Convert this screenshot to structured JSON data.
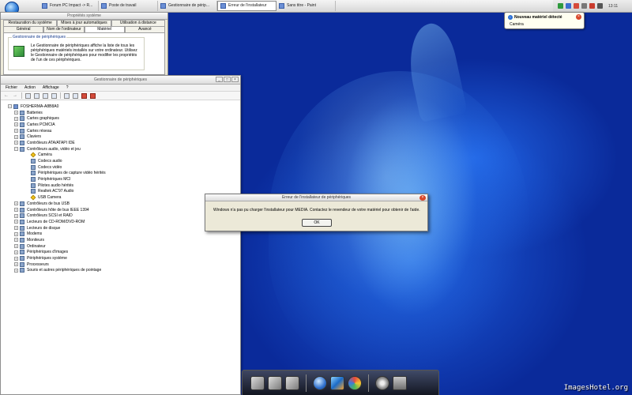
{
  "taskbar": {
    "items": [
      {
        "label": "Forum PC Impact -> R...",
        "active": false
      },
      {
        "label": "Poste de travail",
        "active": false
      },
      {
        "label": "Gestionnaire de périp...",
        "active": false
      },
      {
        "label": "Erreur de l'installateur",
        "active": true
      },
      {
        "label": "Sans titre - Paint",
        "active": false
      }
    ],
    "clock": "13:11"
  },
  "balloon": {
    "title": "Nouveau matériel détecté",
    "body": "Caméra"
  },
  "system_properties": {
    "title": "Propriétés système",
    "tabs_row1": [
      "Restauration du système",
      "Mises à jour automatiques",
      "Utilisation à distance"
    ],
    "tabs_row2": [
      "Général",
      "Nom de l'ordinateur",
      "Matériel",
      "Avancé"
    ],
    "selected_tab": "Matériel",
    "group_label": "Gestionnaire de périphériques",
    "group_text": "Le Gestionnaire de périphériques affiche la liste de tous les périphériques matériels installés sur votre ordinateur. Utilisez le Gestionnaire de périphériques pour modifier les propriétés de l'un de ces périphériques."
  },
  "device_manager": {
    "title": "Gestionnaire de périphériques",
    "menu": [
      "Fichier",
      "Action",
      "Affichage",
      "?"
    ],
    "tree": [
      {
        "label": "FOSHERMA-A8B8A0",
        "level": 0,
        "expander": "-",
        "icon": "computer"
      },
      {
        "label": "Batteries",
        "level": 1,
        "expander": "+",
        "icon": "battery"
      },
      {
        "label": "Cartes graphiques",
        "level": 1,
        "expander": "+",
        "icon": "display"
      },
      {
        "label": "Cartes PCMCIA",
        "level": 1,
        "expander": "+",
        "icon": "pcmcia"
      },
      {
        "label": "Cartes réseau",
        "level": 1,
        "expander": "+",
        "icon": "network"
      },
      {
        "label": "Claviers",
        "level": 1,
        "expander": "+",
        "icon": "keyboard"
      },
      {
        "label": "Contrôleurs ATA/ATAPI IDE",
        "level": 1,
        "expander": "+",
        "icon": "ide"
      },
      {
        "label": "Contrôleurs audio, vidéo et jeu",
        "level": 1,
        "expander": "-",
        "icon": "audio"
      },
      {
        "label": "Caméra",
        "level": 2,
        "expander": "",
        "icon": "warning"
      },
      {
        "label": "Codecs audio",
        "level": 2,
        "expander": "",
        "icon": "codec"
      },
      {
        "label": "Codecs vidéo",
        "level": 2,
        "expander": "",
        "icon": "codec"
      },
      {
        "label": "Périphériques de capture vidéo hérités",
        "level": 2,
        "expander": "",
        "icon": "codec"
      },
      {
        "label": "Périphériques MCI",
        "level": 2,
        "expander": "",
        "icon": "codec"
      },
      {
        "label": "Pilotes audio hérités",
        "level": 2,
        "expander": "",
        "icon": "codec"
      },
      {
        "label": "Realtek AC'97 Audio",
        "level": 2,
        "expander": "",
        "icon": "codec"
      },
      {
        "label": "USB Camera",
        "level": 2,
        "expander": "",
        "icon": "warning"
      },
      {
        "label": "Contrôleurs de bus USB",
        "level": 1,
        "expander": "+",
        "icon": "usb"
      },
      {
        "label": "Contrôleurs hôte de bus IEEE 1394",
        "level": 1,
        "expander": "+",
        "icon": "ieee"
      },
      {
        "label": "Contrôleurs SCSI et RAID",
        "level": 1,
        "expander": "+",
        "icon": "scsi"
      },
      {
        "label": "Lecteurs de CD-ROM/DVD-ROM",
        "level": 1,
        "expander": "+",
        "icon": "cdrom"
      },
      {
        "label": "Lecteurs de disque",
        "level": 1,
        "expander": "+",
        "icon": "disk"
      },
      {
        "label": "Modems",
        "level": 1,
        "expander": "+",
        "icon": "modem"
      },
      {
        "label": "Moniteurs",
        "level": 1,
        "expander": "+",
        "icon": "monitor"
      },
      {
        "label": "Ordinateur",
        "level": 1,
        "expander": "+",
        "icon": "computer"
      },
      {
        "label": "Périphériques d'images",
        "level": 1,
        "expander": "+",
        "icon": "imaging"
      },
      {
        "label": "Périphériques système",
        "level": 1,
        "expander": "+",
        "icon": "system"
      },
      {
        "label": "Processeurs",
        "level": 1,
        "expander": "+",
        "icon": "cpu"
      },
      {
        "label": "Souris et autres périphériques de pointage",
        "level": 1,
        "expander": "+",
        "icon": "mouse"
      }
    ]
  },
  "error_dialog": {
    "title": "Erreur de l'installateur de périphériques",
    "message": "Windows n'a pas pu charger l'installateur pour MEDIA. Contactez le revendeur de votre matériel pour obtenir de l'aide.",
    "ok_label": "OK"
  },
  "watermark": "ImagesHotel.org",
  "colors": {
    "desktop_blue": "#0b2f9e",
    "window_bg": "#ece9d8",
    "close_red": "#d9482b"
  }
}
